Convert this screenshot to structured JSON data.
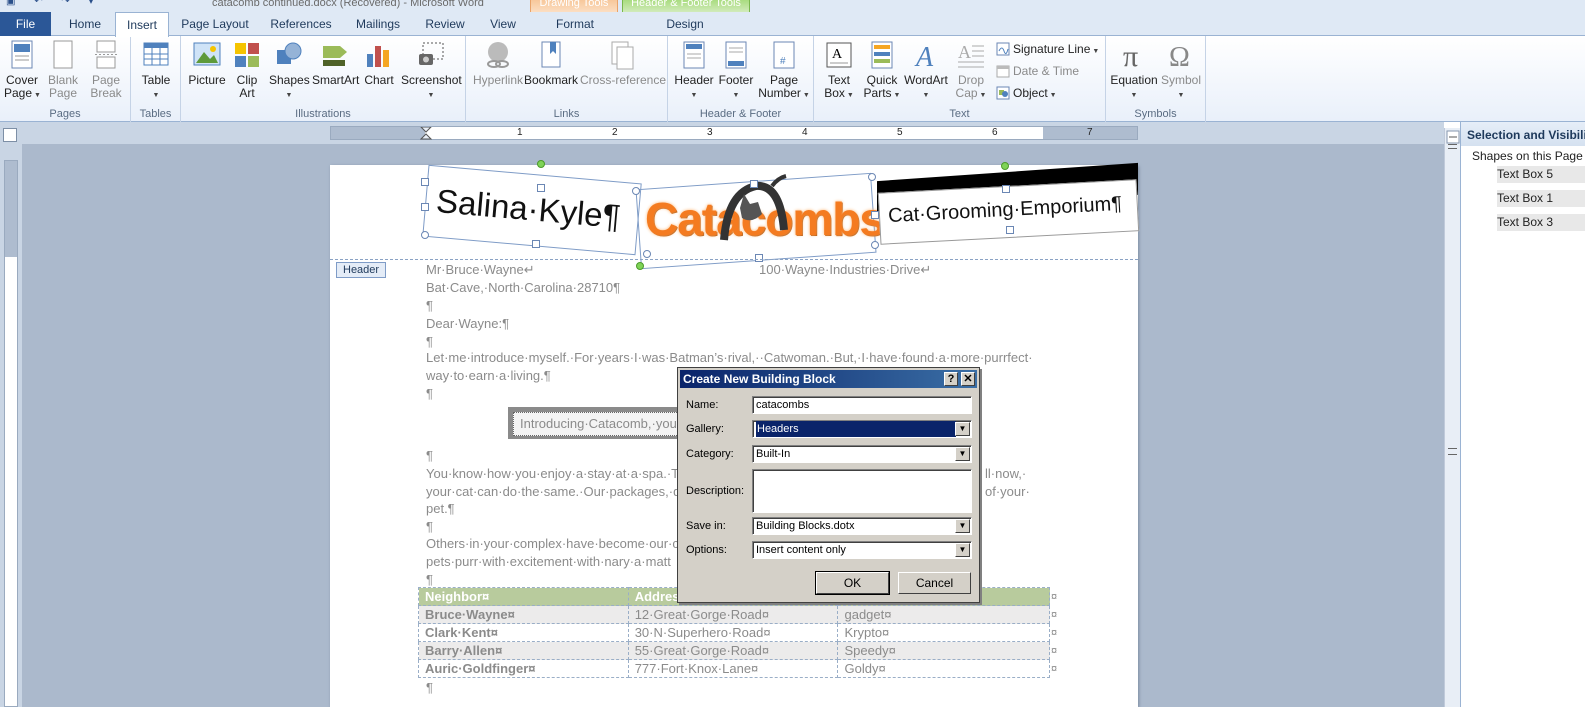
{
  "window": {
    "title": "catacomb continued.docx (Recovered) - Microsoft Word"
  },
  "context_tabs": {
    "drawing_tools": "Drawing Tools",
    "header_footer_tools": "Header & Footer Tools"
  },
  "tabs": {
    "file": "File",
    "home": "Home",
    "insert": "Insert",
    "page_layout": "Page Layout",
    "references": "References",
    "mailings": "Mailings",
    "review": "Review",
    "view": "View",
    "format": "Format",
    "design": "Design"
  },
  "ribbon": {
    "pages": {
      "label": "Pages",
      "cover_page_1": "Cover",
      "cover_page_2": "Page",
      "blank_page_1": "Blank",
      "blank_page_2": "Page",
      "page_break_1": "Page",
      "page_break_2": "Break"
    },
    "tables": {
      "label": "Tables",
      "table": "Table"
    },
    "illustrations": {
      "label": "Illustrations",
      "picture": "Picture",
      "clip_art_1": "Clip",
      "clip_art_2": "Art",
      "shapes": "Shapes",
      "smartart": "SmartArt",
      "chart": "Chart",
      "screenshot": "Screenshot"
    },
    "links": {
      "label": "Links",
      "hyperlink": "Hyperlink",
      "bookmark": "Bookmark",
      "cross_reference": "Cross-reference"
    },
    "header_footer": {
      "label": "Header & Footer",
      "header": "Header",
      "footer": "Footer",
      "page_number_1": "Page",
      "page_number_2": "Number"
    },
    "text": {
      "label": "Text",
      "text_box_1": "Text",
      "text_box_2": "Box",
      "quick_parts_1": "Quick",
      "quick_parts_2": "Parts",
      "wordart": "WordArt",
      "drop_cap_1": "Drop",
      "drop_cap_2": "Cap",
      "signature_line": "Signature Line",
      "date_time": "Date & Time",
      "object": "Object"
    },
    "symbols": {
      "label": "Symbols",
      "equation": "Equation",
      "symbol": "Symbol"
    }
  },
  "ruler_numbers": [
    "1",
    "2",
    "3",
    "4",
    "5",
    "6",
    "7"
  ],
  "selection_pane": {
    "title": "Selection and Visibility",
    "subtitle": "Shapes on this Page",
    "items": [
      "Text Box 5",
      "Text Box 1",
      "Text Box 3"
    ]
  },
  "header": {
    "tag": "Header",
    "brand_left": "Salina·Kyle¶",
    "brand_center": "Catacombs¶",
    "brand_right": "Cat·Grooming·Emporium¶"
  },
  "letter": {
    "line_name": "Mr·Bruce·Wayne↵",
    "line_address_right": "100·Wayne·Industries·Drive↵",
    "line_city": "Bat·Cave,·North·Carolina·28710¶",
    "pilcrow": "¶",
    "salutation": "Dear·Wayne:¶",
    "para1_a": "Let·me·introduce·myself.·For·years·I·was·Batman’s·rival,··Catwoman.·But,·I·have·found·a·more·purrfect·",
    "para1_b": "way·to·earn·a·living.¶",
    "callout": "Introducing·Catacomb,·you",
    "para2_a": "You·know·how·you·enjoy·a·stay·at·a·spa.·Th",
    "para2_a_right": "ll·now,·",
    "para2_b": "your·cat·can·do·the·same.·Our·packages,·d",
    "para2_b_right": "of·your·",
    "para2_c": "pet.¶",
    "para3_a": "Others·in·your·complex·have·become·our·c",
    "para3_b": "pets·purr·with·excitement·with·nary·a·matt"
  },
  "table": {
    "headers": [
      "Neighbor¤",
      "Addres",
      ""
    ],
    "rows": [
      [
        "Bruce·Wayne¤",
        "12·Great·Gorge·Road¤",
        "gadget¤"
      ],
      [
        "Clark·Kent¤",
        "30·N·Superhero·Road¤",
        "Krypto¤"
      ],
      [
        "Barry·Allen¤",
        "55·Great·Gorge·Road¤",
        "Speedy¤"
      ],
      [
        "Auric·Goldfinger¤",
        "777·Fort·Knox·Lane¤",
        "Goldy¤"
      ]
    ],
    "end_mark": "¤"
  },
  "dialog": {
    "title": "Create New Building Block",
    "help": "?",
    "close": "✕",
    "name_label": "Name:",
    "name_value": "catacombs",
    "gallery_label": "Gallery:",
    "gallery_value": "Headers",
    "category_label": "Category:",
    "category_value": "Built-In",
    "description_label": "Description:",
    "description_value": "",
    "save_in_label": "Save in:",
    "save_in_value": "Building Blocks.dotx",
    "options_label": "Options:",
    "options_value": "Insert content only",
    "ok": "OK",
    "cancel": "Cancel"
  }
}
